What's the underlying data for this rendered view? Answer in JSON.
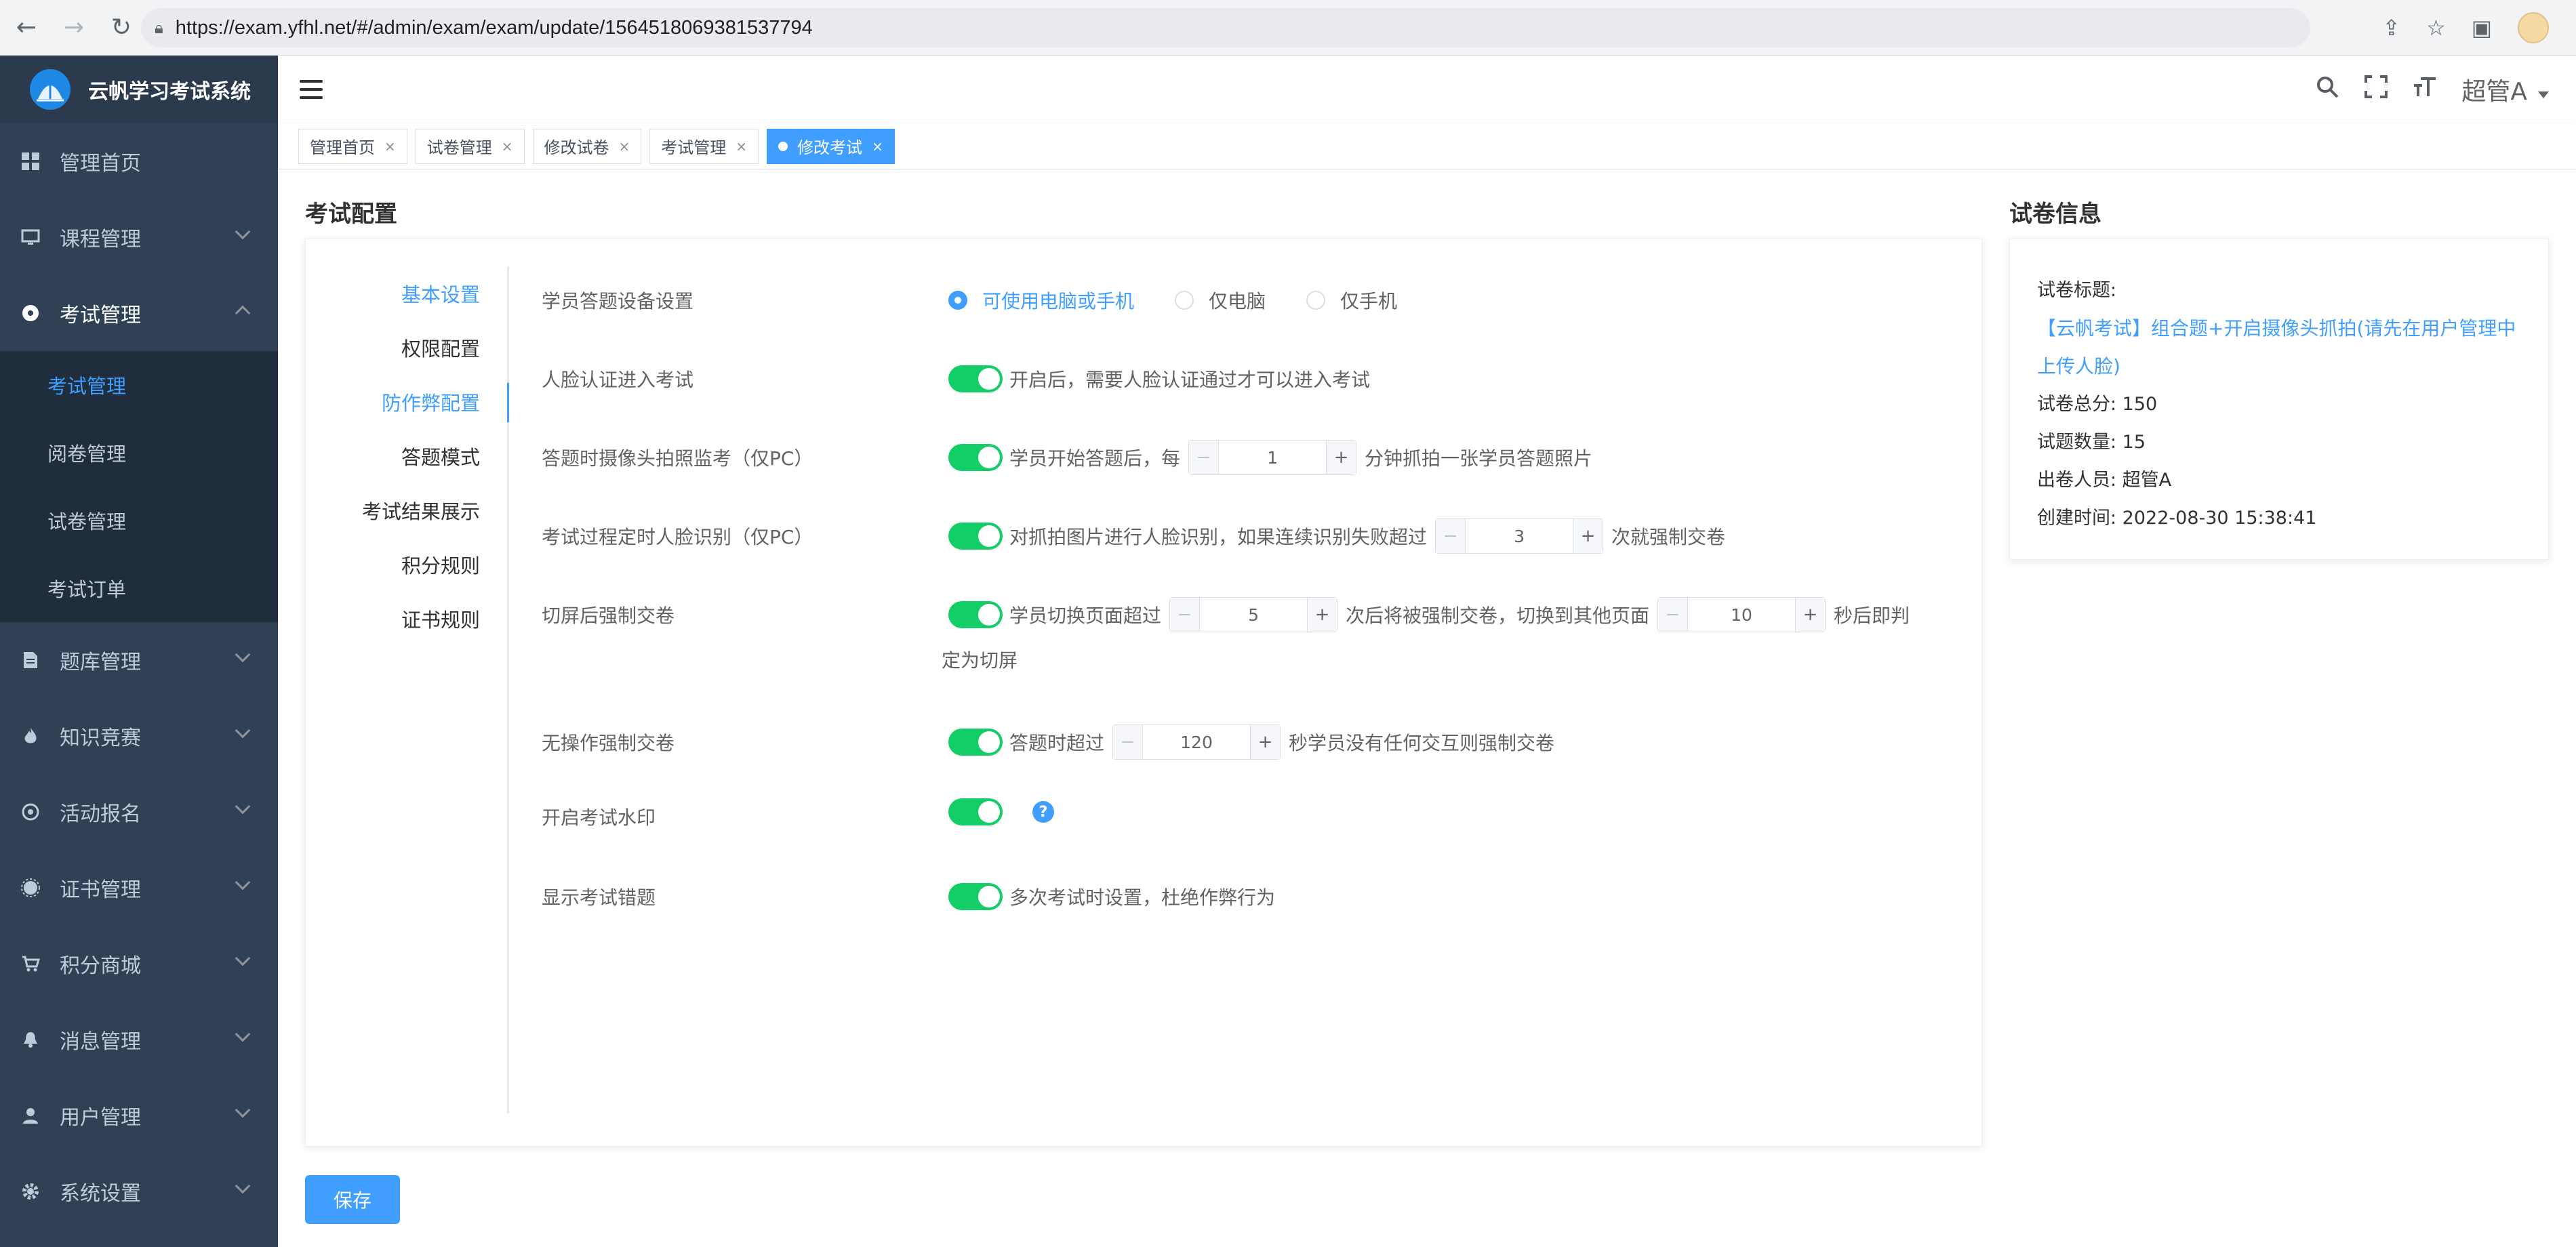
{
  "browser": {
    "url": "https://exam.yfhl.net/#/admin/exam/exam/update/1564518069381537794"
  },
  "app": {
    "title": "云帆学习考试系统",
    "user": "超管A"
  },
  "sidebar": {
    "items": [
      {
        "label": "管理首页",
        "icon": "dashboard-icon"
      },
      {
        "label": "课程管理",
        "icon": "monitor-icon"
      },
      {
        "label": "考试管理",
        "icon": "compass-icon"
      },
      {
        "label": "题库管理",
        "icon": "document-icon"
      },
      {
        "label": "知识竞赛",
        "icon": "fire-icon"
      },
      {
        "label": "活动报名",
        "icon": "target-icon"
      },
      {
        "label": "证书管理",
        "icon": "badge-icon"
      },
      {
        "label": "积分商城",
        "icon": "cart-icon"
      },
      {
        "label": "消息管理",
        "icon": "bell-icon"
      },
      {
        "label": "用户管理",
        "icon": "user-icon"
      },
      {
        "label": "系统设置",
        "icon": "gear-icon"
      }
    ],
    "exam_sub": [
      "考试管理",
      "阅卷管理",
      "试卷管理",
      "考试订单"
    ]
  },
  "tags": [
    "管理首页",
    "试卷管理",
    "修改试卷",
    "考试管理",
    "修改考试"
  ],
  "config": {
    "title": "考试配置",
    "anchors": [
      "基本设置",
      "权限配置",
      "防作弊配置",
      "答题模式",
      "考试结果展示",
      "积分规则",
      "证书规则"
    ],
    "device": {
      "label": "学员答题设备设置",
      "options": [
        "可使用电脑或手机",
        "仅电脑",
        "仅手机"
      ]
    },
    "face_entry": {
      "label": "人脸认证进入考试",
      "text": "开启后，需要人脸认证通过才可以进入考试"
    },
    "camera": {
      "label": "答题时摄像头拍照监考（仅PC）",
      "pre": "学员开始答题后，每",
      "value": "1",
      "post": "分钟抓拍一张学员答题照片"
    },
    "face_timed": {
      "label": "考试过程定时人脸识别（仅PC）",
      "pre": "对抓拍图片进行人脸识别，如果连续识别失败超过",
      "value": "3",
      "post": "次就强制交卷"
    },
    "switch_screen": {
      "label": "切屏后强制交卷",
      "pre": "学员切换页面超过",
      "value1": "5",
      "mid": "次后将被强制交卷，切换到其他页面",
      "value2": "10",
      "post": "秒后即判",
      "post2": "定为切屏"
    },
    "idle": {
      "label": "无操作强制交卷",
      "pre": "答题时超过",
      "value": "120",
      "post": "秒学员没有任何交互则强制交卷"
    },
    "watermark": {
      "label": "开启考试水印",
      "help": "?"
    },
    "wrong": {
      "label": "显示考试错题",
      "text": "多次考试时设置，杜绝作弊行为"
    },
    "save": "保存"
  },
  "paper": {
    "title": "试卷信息",
    "title_label": "试卷标题:",
    "paper_title": "【云帆考试】组合题+开启摄像头抓拍(请先在用户管理中上传人脸)",
    "paper_title_line1": "【云帆考试】组合题+开启摄像头抓拍(请先在用户管理中",
    "paper_title_line2": "上传人脸)",
    "total": "试卷总分:  150",
    "count": "试题数量:   15",
    "author": "出卷人员:  超管A",
    "created": "创建时间:  2022-08-30 15:38:41"
  },
  "colors": {
    "primary": "#409eff",
    "switch_on": "#13ce66",
    "sidebar": "#304156",
    "sidebar_sub": "#1f2d3d"
  }
}
